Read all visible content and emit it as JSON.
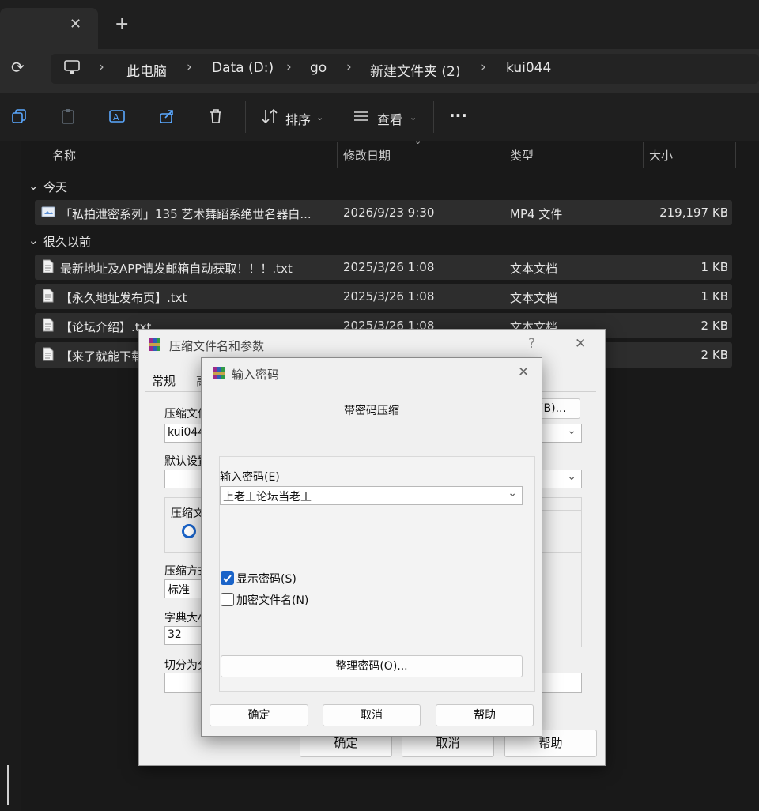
{
  "explorer": {
    "tab_close": "✕",
    "tab_new": "+",
    "breadcrumbs": [
      "此电脑",
      "Data (D:)",
      "go",
      "新建文件夹 (2)",
      "kui044"
    ],
    "toolbar": {
      "sort_label": "排序",
      "view_label": "查看",
      "more_label": "···"
    },
    "columns": [
      "名称",
      "修改日期",
      "类型",
      "大小"
    ],
    "groups": [
      {
        "label": "今天",
        "files": [
          {
            "name": "「私拍泄密系列」135 艺术舞蹈系绝世名器白...",
            "date": "2026/9/23 9:30",
            "type": "MP4 文件",
            "size": "219,197 KB"
          }
        ]
      },
      {
        "label": "很久以前",
        "files": [
          {
            "name": "最新地址及APP请发邮箱自动获取！！！.txt",
            "date": "2025/3/26 1:08",
            "type": "文本文档",
            "size": "1 KB"
          },
          {
            "name": "【永久地址发布页】.txt",
            "date": "2025/3/26 1:08",
            "type": "文本文档",
            "size": "1 KB"
          },
          {
            "name": "【论坛介绍】.txt",
            "date": "2025/3/26 1:08",
            "type": "文本文档",
            "size": "2 KB"
          },
          {
            "name": "【来了就能下载",
            "date": "",
            "type": "",
            "size": "2 KB"
          }
        ]
      }
    ]
  },
  "archive_dialog": {
    "title": "压缩文件名和参数",
    "help_glyph": "?",
    "close_glyph": "✕",
    "tab_general": "常规",
    "tab_advanced_partial": "高",
    "archive_name_label": "压缩文件",
    "archive_name_value": "kui044",
    "browse_button": "(B)...",
    "default_profile_label": "默认设置",
    "format_label": "压缩文",
    "method_label": "压缩方式",
    "method_value": "标准",
    "dict_label": "字典大小",
    "dict_value": "32",
    "split_label": "切分为分",
    "ok_button": "确定",
    "cancel_button": "取消",
    "help_button": "帮助"
  },
  "password_dialog": {
    "title": "输入密码",
    "close_glyph": "✕",
    "heading": "带密码压缩",
    "password_label": "输入密码(E)",
    "password_value": "上老王论坛当老王",
    "show_password_label": "显示密码(S)",
    "show_password_checked": true,
    "encrypt_names_label": "加密文件名(N)",
    "encrypt_names_checked": false,
    "organize_button": "整理密码(O)...",
    "ok_button": "确定",
    "cancel_button": "取消",
    "help_button": "帮助"
  },
  "colors": {
    "accent": "#1a63c8",
    "row_bg": "#2d2d2d",
    "dialog_bg": "#f0f0f0"
  }
}
